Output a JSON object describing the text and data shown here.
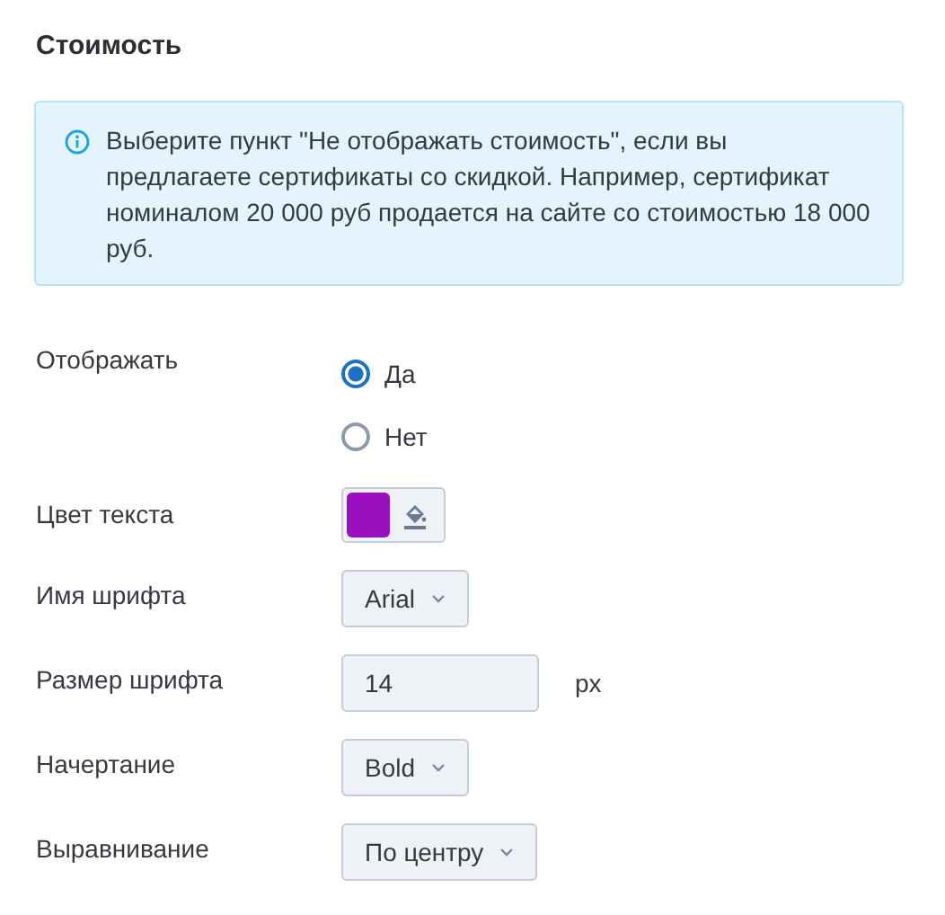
{
  "title": "Стоимость",
  "info": {
    "text": "Выберите пункт \"Не отображать стоимость\", если вы предлагаете сертификаты со скидкой. Например, сертификат номиналом 20 000 руб продается на сайте со стоимостью 18 000 руб."
  },
  "fields": [
    {
      "kind": "radio",
      "label": "Отображать",
      "options": [
        {
          "label": "Да",
          "selected": true
        },
        {
          "label": "Нет",
          "selected": false
        }
      ]
    },
    {
      "kind": "color",
      "label": "Цвет текста",
      "color": "#9a0fbe"
    },
    {
      "kind": "select",
      "label": "Имя шрифта",
      "value": "Arial"
    },
    {
      "kind": "number",
      "label": "Размер шрифта",
      "value": "14",
      "unit": "px"
    },
    {
      "kind": "select",
      "label": "Начертание",
      "value": "Bold"
    },
    {
      "kind": "select",
      "label": "Выравнивание",
      "value": "По центру"
    }
  ]
}
